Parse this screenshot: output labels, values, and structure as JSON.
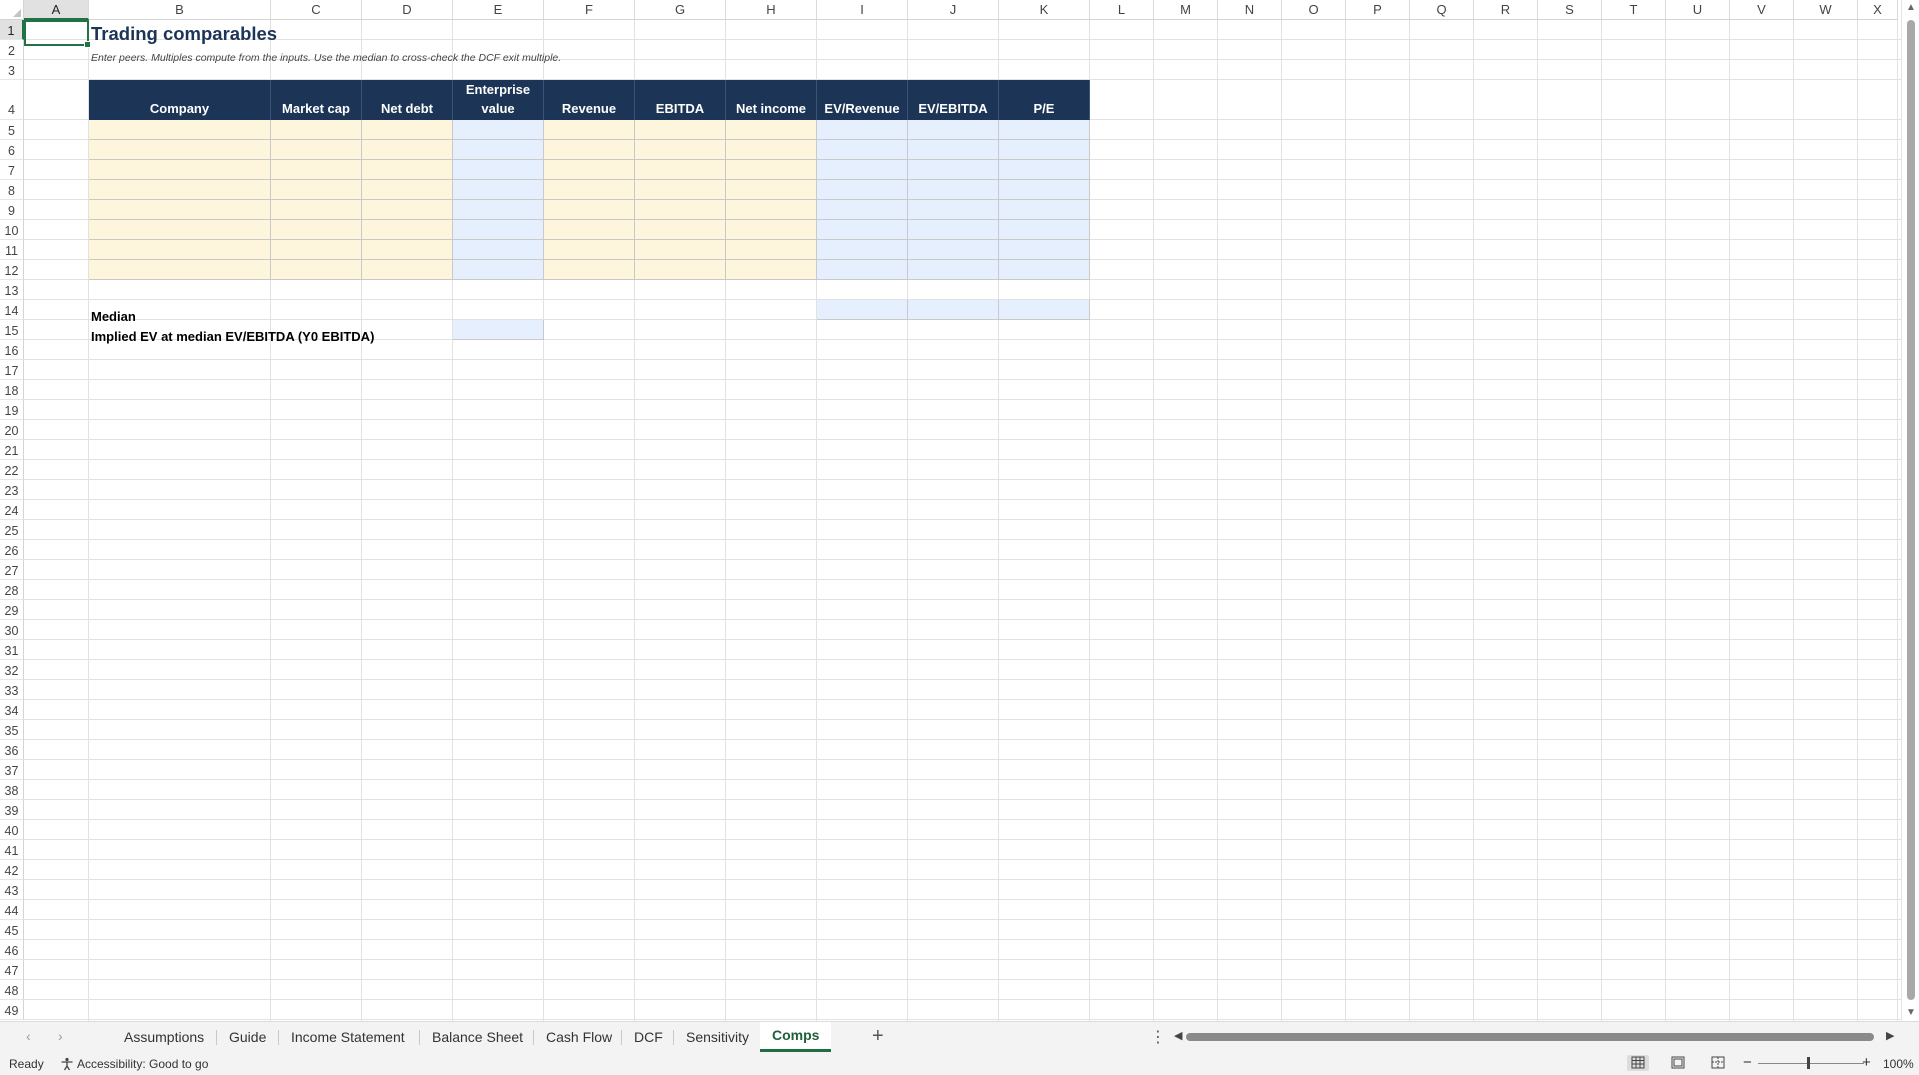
{
  "columns": [
    "A",
    "B",
    "C",
    "D",
    "E",
    "F",
    "G",
    "H",
    "I",
    "J",
    "K",
    "L",
    "M",
    "N",
    "O",
    "P",
    "Q",
    "R",
    "S",
    "T",
    "U",
    "V",
    "W",
    "X"
  ],
  "rows_visible": [
    "1",
    "2",
    "3",
    "4",
    "5",
    "6",
    "7",
    "8",
    "9",
    "10",
    "11",
    "12",
    "13",
    "14",
    "15",
    "16",
    "17",
    "18",
    "19",
    "20",
    "21",
    "22",
    "23",
    "24",
    "25",
    "26",
    "27",
    "28",
    "29",
    "30",
    "31",
    "32",
    "33",
    "34",
    "35",
    "36",
    "37",
    "38",
    "39",
    "40",
    "41",
    "42",
    "43",
    "44",
    "45",
    "46",
    "47",
    "48",
    "49"
  ],
  "selected_cell": "A1",
  "sheet": {
    "title": "Trading comparables",
    "subtitle": "Enter peers. Multiples compute from the inputs. Use the median to cross-check the DCF exit multiple.",
    "table_headers": [
      "Company",
      "Market cap",
      "Net debt",
      "Enterprise\nvalue",
      "Revenue",
      "EBITDA",
      "Net income",
      "EV/Revenue",
      "EV/EBITDA",
      "P/E"
    ],
    "median_label": "Median",
    "implied_label": "Implied EV at median EV/EBITDA (Y0 EBITDA)"
  },
  "tabs": [
    "Assumptions",
    "Guide",
    "Income Statement",
    "Balance Sheet",
    "Cash Flow",
    "DCF",
    "Sensitivity",
    "Comps"
  ],
  "active_tab": "Comps",
  "status": {
    "ready": "Ready",
    "accessibility": "Accessibility: Good to go",
    "zoom": "100%"
  },
  "colors": {
    "header_navy": "#1c3557",
    "input_fill": "#fdf5dc",
    "calc_fill": "#e6effd",
    "excel_green": "#217346"
  },
  "icons": [
    "accessibility-icon",
    "normal-view-icon",
    "page-layout-view-icon",
    "page-break-view-icon",
    "add-sheet-icon",
    "more-options-icon"
  ]
}
